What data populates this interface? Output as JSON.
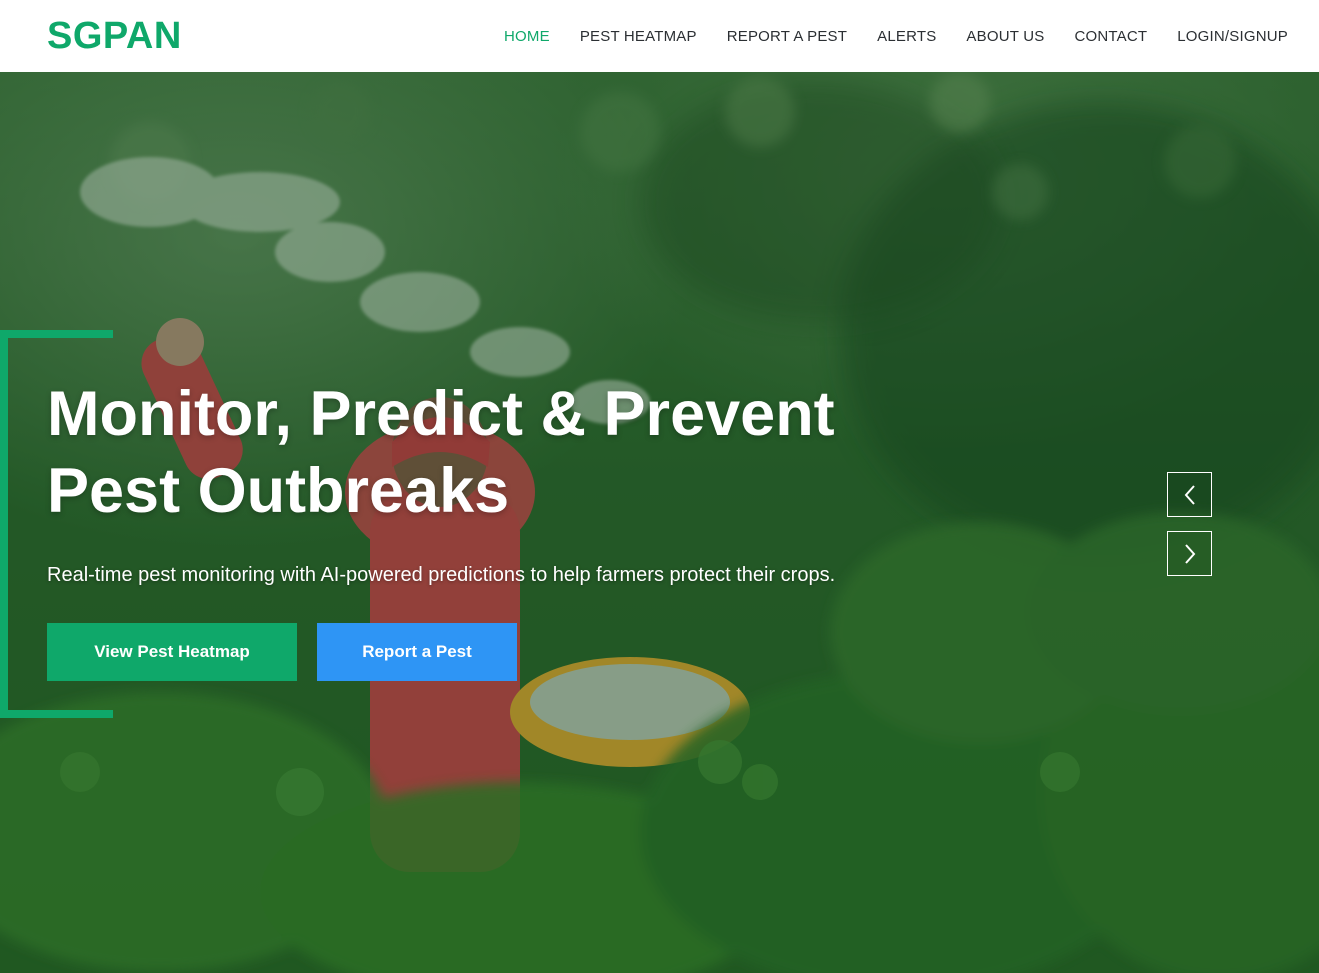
{
  "brand": {
    "name": "SGPAN",
    "color": "#0fa86a"
  },
  "nav": {
    "items": [
      {
        "label": "HOME",
        "active": true
      },
      {
        "label": "PEST HEATMAP",
        "active": false
      },
      {
        "label": "REPORT A PEST",
        "active": false
      },
      {
        "label": "ALERTS",
        "active": false
      },
      {
        "label": "ABOUT US",
        "active": false
      },
      {
        "label": "CONTACT",
        "active": false
      },
      {
        "label": "LOGIN/SIGNUP",
        "active": false
      }
    ]
  },
  "hero": {
    "title_line1": "Monitor, Predict & Prevent",
    "title_line2": "Pest Outbreaks",
    "subtitle": "Real-time pest monitoring with AI-powered predictions to help farmers protect their crops.",
    "primary_button": "View Pest Heatmap",
    "secondary_button": "Report a Pest",
    "carousel_prev_icon": "chevron-left-icon",
    "carousel_next_icon": "chevron-right-icon"
  },
  "colors": {
    "accent_green": "#0fa86a",
    "accent_blue": "#2e95f5"
  }
}
